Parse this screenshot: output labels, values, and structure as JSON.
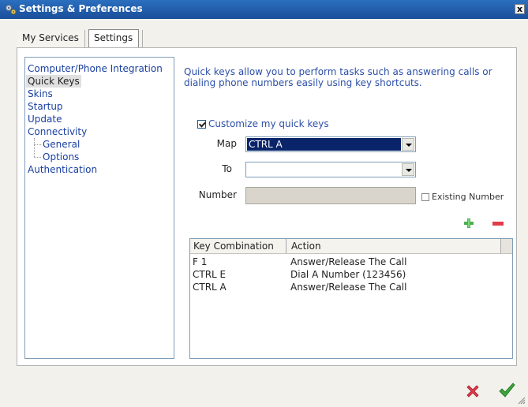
{
  "window": {
    "title": "Settings & Preferences",
    "close_label": "x"
  },
  "tabs": [
    {
      "label": "My Services"
    },
    {
      "label": "Settings"
    }
  ],
  "nav": {
    "items": [
      {
        "label": "Computer/Phone Integration"
      },
      {
        "label": "Quick Keys"
      },
      {
        "label": "Skins"
      },
      {
        "label": "Startup"
      },
      {
        "label": "Update"
      },
      {
        "label": "Connectivity"
      },
      {
        "label": "General"
      },
      {
        "label": "Options"
      },
      {
        "label": "Authentication"
      }
    ],
    "selected": "Quick Keys"
  },
  "quick_keys": {
    "intro": "Quick keys allow you to perform tasks such as answering calls or dialing phone numbers easily using key shortcuts.",
    "customize_label": "Customize my quick keys",
    "customize_checked": true,
    "map_label": "Map",
    "map_value": "CTRL A",
    "to_label": "To",
    "to_value": "",
    "number_label": "Number",
    "number_value": "",
    "existing_number_label": "Existing Number",
    "existing_number_checked": false
  },
  "table": {
    "columns": [
      "Key Combination",
      "Action"
    ],
    "rows": [
      {
        "key": "F 1",
        "action": "Answer/Release The Call"
      },
      {
        "key": "CTRL E",
        "action": "Dial A Number (123456)"
      },
      {
        "key": "CTRL A",
        "action": "Answer/Release The Call"
      }
    ]
  },
  "colors": {
    "title_bar": "#1a4f9a",
    "link_blue": "#2b4fa8",
    "selection": "#0a246a",
    "add_green": "#4caf50",
    "remove_red": "#e13b4a",
    "ok_green": "#3aa53a"
  },
  "icons": {
    "title": "settings-gears-icon",
    "add": "plus-icon",
    "remove": "minus-icon",
    "cancel": "red-x-icon",
    "ok": "green-check-icon"
  }
}
